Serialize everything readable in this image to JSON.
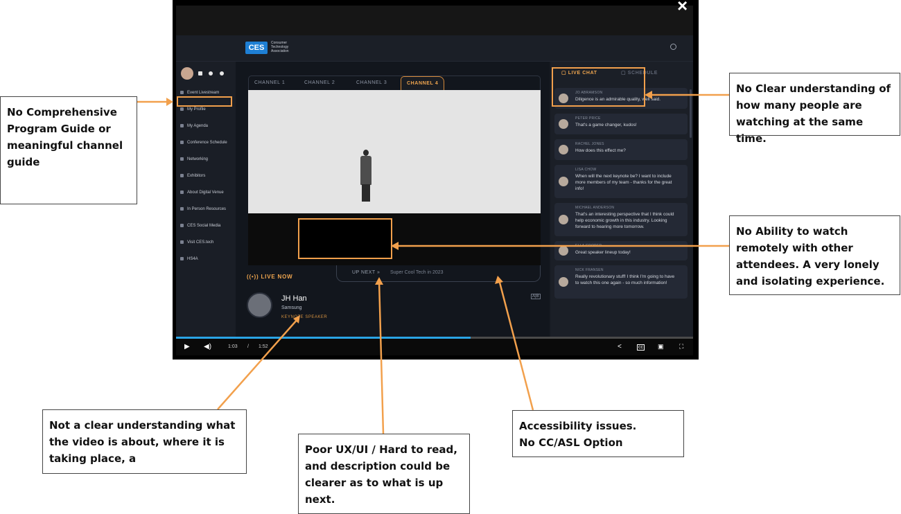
{
  "player": {
    "close_icon": "×",
    "header": {
      "logo": "CES",
      "org_lines": [
        "Consumer",
        "Technology",
        "Association"
      ]
    },
    "left_nav": {
      "items": [
        {
          "label": "Event Livestream"
        },
        {
          "label": "My Profile"
        },
        {
          "label": "My Agenda"
        },
        {
          "label": "Conference Schedule"
        },
        {
          "label": "Networking"
        },
        {
          "label": "Exhibitors"
        },
        {
          "label": "About Digital Venue"
        },
        {
          "label": "In Person Resources"
        },
        {
          "label": "CES Social Media"
        },
        {
          "label": "Visit CES.tech"
        },
        {
          "label": "HS4A"
        }
      ]
    },
    "channels": [
      "CHANNEL 1",
      "CHANNEL 2",
      "CHANNEL 3",
      "CHANNEL 4"
    ],
    "active_channel": "CHANNEL 4",
    "up_next": {
      "label": "UP NEXT",
      "chevrons": "»",
      "title": "Super Cool Tech in 2023"
    },
    "live_now": "LIVE NOW",
    "speaker": {
      "name": "JH Han",
      "company": "Samsung",
      "role": "KEYNOTE SPEAKER"
    },
    "asl_badge": "A|B",
    "right_panel": {
      "tabs": [
        "LIVE CHAT",
        "SCHEDULE"
      ],
      "messages": [
        {
          "name": "JO ABRAMSON",
          "text": "Diligence is an admirable quality, well said."
        },
        {
          "name": "PETER PRICE",
          "text": "That's a game changer, kudos!"
        },
        {
          "name": "RACHEL JONES",
          "text": "How does this effect me?"
        },
        {
          "name": "LISA CHOW",
          "text": "When will the next keynote be? I want to include more members of my team - thanks for the great info!"
        },
        {
          "name": "MICHAEL ANDERSON",
          "text": "That's an interesting perspective that I think could help economic growth in this industry. Looking forward to hearing more tomorrow."
        },
        {
          "name": "ELLA COOPER",
          "text": "Great speaker lineup today!"
        },
        {
          "name": "NICK FRANSEN",
          "text": "Really revolutionary stuff! I think I'm going to have to watch this one again - so much information!"
        }
      ]
    },
    "controls": {
      "current_time": "1:03",
      "separator": "/",
      "duration": "1:52",
      "progress": 0.57
    }
  },
  "callouts": {
    "program_guide": [
      "No Comprehensive",
      "Program Guide or",
      "meaningful channel",
      "guide"
    ],
    "viewer_count": [
      "No Clear understanding of",
      "how many people are",
      "watching at the same time."
    ],
    "watch_together": [
      "No Ability to watch",
      "remotely with other",
      "attendees. A very lonely",
      "and isolating experience."
    ],
    "video_context": [
      "Not a clear understanding what",
      "the video is about, where it is",
      "taking place, a"
    ],
    "poor_ux": [
      "Poor UX/UI / Hard to read,",
      "and description could be",
      "clearer as to what is up",
      "next."
    ],
    "accessibility": [
      "Accessibility issues.",
      "No CC/ASL Option"
    ]
  },
  "colors": {
    "accent_orange": "#f0a64f",
    "annotation_orange": "#f2a04c",
    "progress_blue": "#2aa4e5",
    "panel_dark": "#14181f"
  }
}
